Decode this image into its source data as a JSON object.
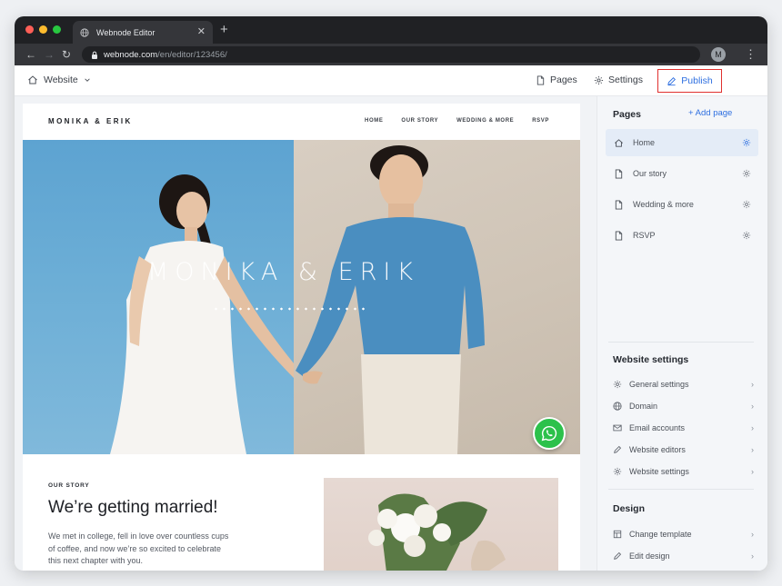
{
  "browser": {
    "tab_title": "Webnode Editor",
    "url_host": "webnode.com",
    "url_path": "/en/editor/123456/",
    "avatar_letter": "M",
    "dot_colors": [
      "#ff5f57",
      "#febc2e",
      "#28c840"
    ]
  },
  "editor": {
    "site_label": "Website",
    "pages_label": "Pages",
    "settings_label": "Settings",
    "publish_label": "Publish",
    "accent_color": "#2e6fe0",
    "highlight_color": "#e0312f"
  },
  "site": {
    "logo": "MONIKA & ERIK",
    "nav": [
      "HOME",
      "OUR STORY",
      "WEDDING & MORE",
      "RSVP"
    ],
    "hero_title": "MONIKA & ERIK",
    "story_label": "OUR STORY",
    "story_heading": "We’re getting married!",
    "story_body": "We met in college, fell in love over countless cups of coffee, and now we’re so excited to celebrate this next chapter with you."
  },
  "panel": {
    "pages_heading": "Pages",
    "add_page": "+ Add page",
    "pages": [
      {
        "label": "Home",
        "icon": "home-icon",
        "active": true
      },
      {
        "label": "Our story",
        "icon": "page-icon",
        "active": false
      },
      {
        "label": "Wedding & more",
        "icon": "page-icon",
        "active": false
      },
      {
        "label": "RSVP",
        "icon": "page-icon",
        "active": false
      }
    ],
    "website_settings_heading": "Website settings",
    "settings": [
      {
        "label": "General settings",
        "icon": "gear-icon"
      },
      {
        "label": "Domain",
        "icon": "globe-icon"
      },
      {
        "label": "Email accounts",
        "icon": "mail-icon"
      },
      {
        "label": "Website editors",
        "icon": "pencil-icon"
      },
      {
        "label": "Website settings",
        "icon": "gear-icon"
      }
    ],
    "design_heading": "Design",
    "design": [
      {
        "label": "Change template",
        "icon": "template-icon"
      },
      {
        "label": "Edit design",
        "icon": "pencil-icon"
      }
    ]
  }
}
